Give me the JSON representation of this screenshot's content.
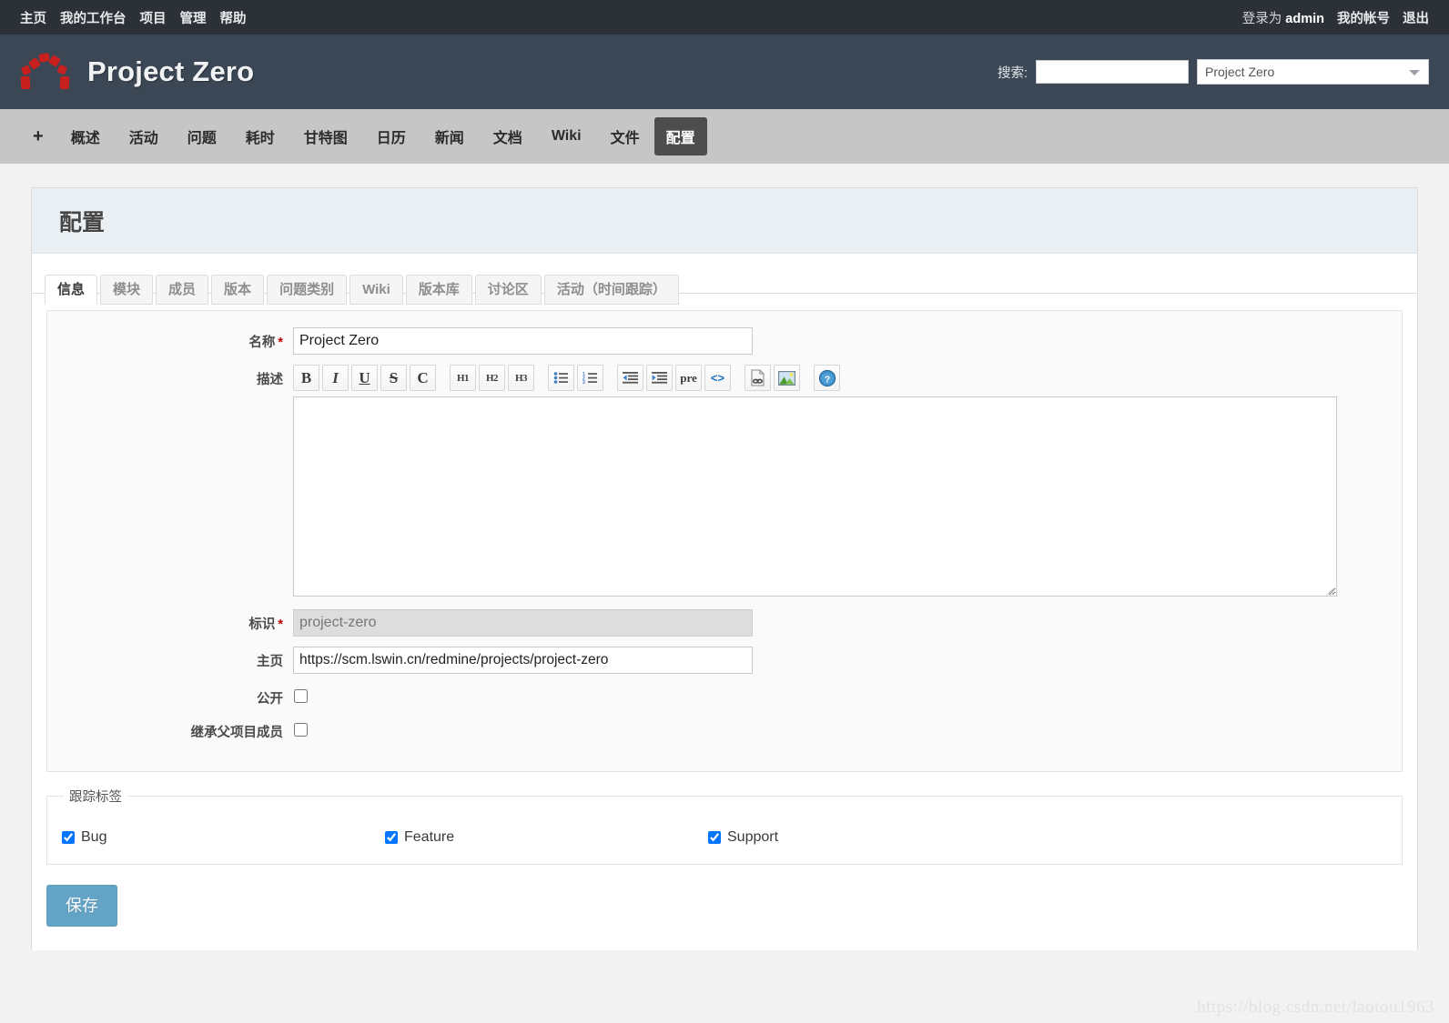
{
  "top_menu": {
    "left_items": [
      {
        "label": "主页",
        "name": "home"
      },
      {
        "label": "我的工作台",
        "name": "my-page"
      },
      {
        "label": "项目",
        "name": "projects"
      },
      {
        "label": "管理",
        "name": "administration"
      },
      {
        "label": "帮助",
        "name": "help"
      }
    ],
    "logged_as_prefix": "登录为",
    "logged_as_user": "admin",
    "account_label": "我的帐号",
    "logout_label": "退出"
  },
  "header": {
    "project_title": "Project Zero",
    "logo_icon": "redmine-arch-logo",
    "search_label": "搜索:",
    "search_value": "",
    "search_placeholder": "",
    "scope_selected": "Project Zero",
    "scope_options": [
      "Project Zero"
    ]
  },
  "main_menu": {
    "add_label": "+",
    "items": [
      {
        "label": "概述",
        "name": "overview",
        "selected": false
      },
      {
        "label": "活动",
        "name": "activity",
        "selected": false
      },
      {
        "label": "问题",
        "name": "issues",
        "selected": false
      },
      {
        "label": "耗时",
        "name": "spent-time",
        "selected": false
      },
      {
        "label": "甘特图",
        "name": "gantt",
        "selected": false
      },
      {
        "label": "日历",
        "name": "calendar",
        "selected": false
      },
      {
        "label": "新闻",
        "name": "news",
        "selected": false
      },
      {
        "label": "文档",
        "name": "documents",
        "selected": false
      },
      {
        "label": "Wiki",
        "name": "wiki",
        "selected": false
      },
      {
        "label": "文件",
        "name": "files",
        "selected": false
      },
      {
        "label": "配置",
        "name": "settings",
        "selected": true
      }
    ]
  },
  "page": {
    "title": "配置"
  },
  "tabs": [
    {
      "label": "信息",
      "name": "tab-info",
      "selected": true
    },
    {
      "label": "模块",
      "name": "tab-modules",
      "selected": false
    },
    {
      "label": "成员",
      "name": "tab-members",
      "selected": false
    },
    {
      "label": "版本",
      "name": "tab-versions",
      "selected": false
    },
    {
      "label": "问题类别",
      "name": "tab-issue-categories",
      "selected": false
    },
    {
      "label": "Wiki",
      "name": "tab-wiki",
      "selected": false
    },
    {
      "label": "版本库",
      "name": "tab-repositories",
      "selected": false
    },
    {
      "label": "讨论区",
      "name": "tab-boards",
      "selected": false
    },
    {
      "label": "活动（时间跟踪）",
      "name": "tab-activities",
      "selected": false
    }
  ],
  "form": {
    "name": {
      "label": "名称",
      "required": "*",
      "value": "Project Zero"
    },
    "description": {
      "label": "描述",
      "value": ""
    },
    "identifier": {
      "label": "标识",
      "required": "*",
      "value": "project-zero",
      "disabled": true
    },
    "homepage": {
      "label": "主页",
      "value": "https://scm.lswin.cn/redmine/projects/project-zero"
    },
    "is_public": {
      "label": "公开",
      "checked": false
    },
    "inherit_members": {
      "label": "继承父项目成员",
      "checked": false
    },
    "toolbar": {
      "buttons": [
        {
          "label": "B",
          "name": "bold-icon",
          "style": "bold"
        },
        {
          "label": "I",
          "name": "italic-icon",
          "style": "italic"
        },
        {
          "label": "U",
          "name": "underline-icon",
          "style": "underline"
        },
        {
          "label": "S",
          "name": "strikethrough-icon",
          "style": "strike"
        },
        {
          "label": "C",
          "name": "inline-code-icon",
          "style": "bold"
        },
        {
          "label": "H1",
          "name": "heading-1-icon",
          "style": "heading"
        },
        {
          "label": "H2",
          "name": "heading-2-icon",
          "style": "heading"
        },
        {
          "label": "H3",
          "name": "heading-3-icon",
          "style": "heading"
        },
        {
          "label": "",
          "name": "unordered-list-icon",
          "style": "ul"
        },
        {
          "label": "",
          "name": "ordered-list-icon",
          "style": "ol"
        },
        {
          "label": "",
          "name": "outdent-icon",
          "style": "outdent"
        },
        {
          "label": "",
          "name": "indent-icon",
          "style": "indent"
        },
        {
          "label": "pre",
          "name": "preformatted-icon",
          "style": "pre"
        },
        {
          "label": "<>",
          "name": "code-tag-icon",
          "style": "codetag"
        },
        {
          "label": "",
          "name": "link-icon",
          "style": "link"
        },
        {
          "label": "",
          "name": "image-icon",
          "style": "image"
        },
        {
          "label": "?",
          "name": "help-icon",
          "style": "help"
        }
      ]
    }
  },
  "trackers": {
    "legend": "跟踪标签",
    "items": [
      {
        "label": "Bug",
        "name": "tracker-bug",
        "checked": true
      },
      {
        "label": "Feature",
        "name": "tracker-feature",
        "checked": true
      },
      {
        "label": "Support",
        "name": "tracker-support",
        "checked": true
      }
    ]
  },
  "actions": {
    "save_label": "保存"
  },
  "watermark": "https://blog.csdn.net/laotou1963",
  "colors": {
    "top_bar": "#2c3138",
    "header": "#3b4754",
    "main_menu": "#c6c6c6",
    "active_tab": "#4d4d4d",
    "content_header": "#e9eff2",
    "save_button": "#62a3c6",
    "logo_red": "#c81f1f",
    "required_star": "#bb0000",
    "page_background": "#f2f2f2"
  }
}
